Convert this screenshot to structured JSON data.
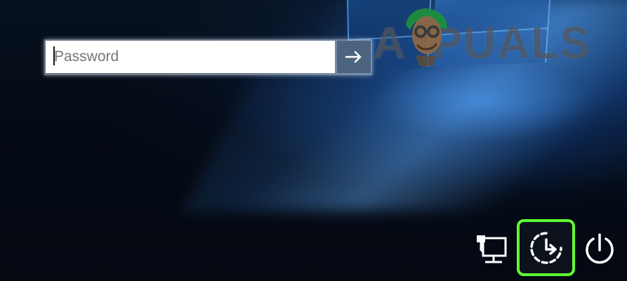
{
  "login_panel": {
    "password_placeholder": "Password"
  },
  "branding": {
    "left_letter": "A",
    "right_text": "PUALS"
  },
  "icons": {
    "submit": "arrow-right-icon",
    "network": "network-icon",
    "accessibility": "ease-of-access-icon",
    "power": "power-icon"
  },
  "colors": {
    "accessibility_highlight": "#60ff34",
    "submit_background": "#4d6480"
  }
}
